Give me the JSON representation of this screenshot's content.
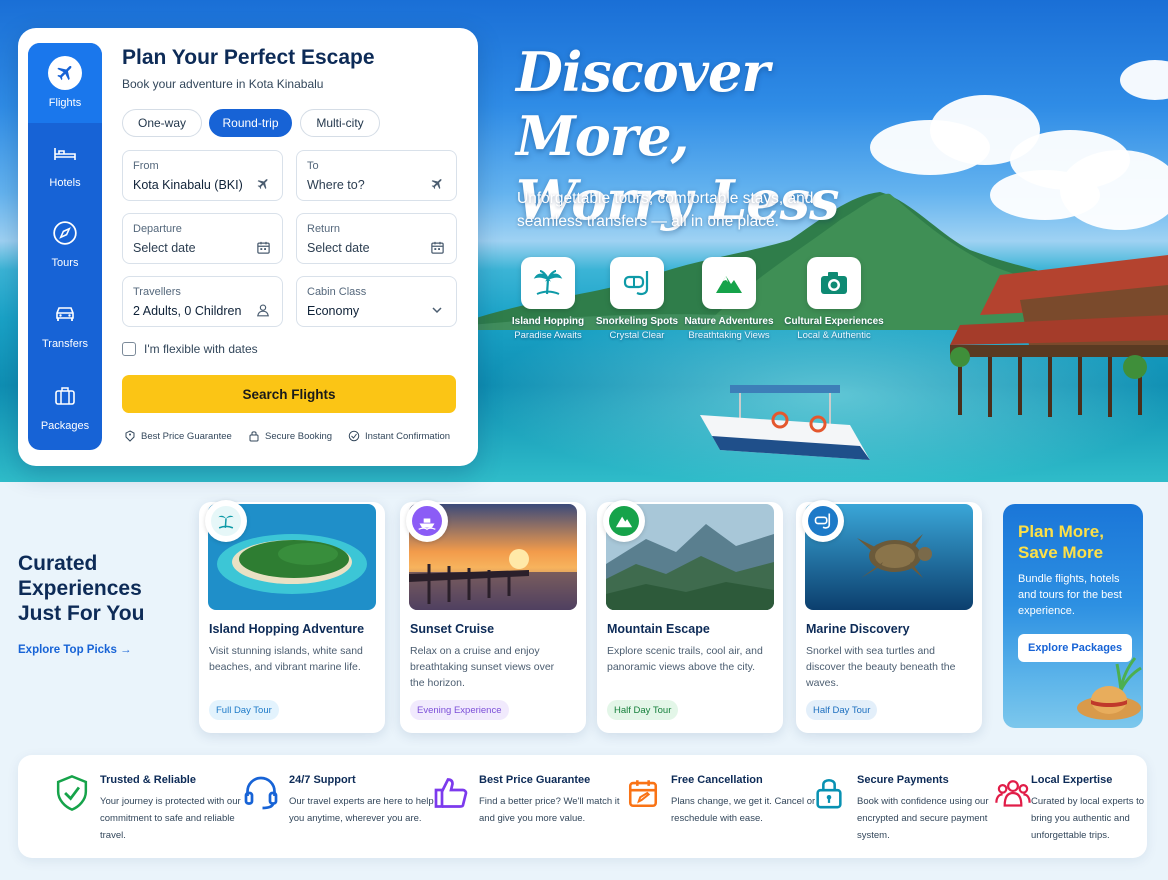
{
  "booking": {
    "tabs": [
      {
        "label": "Flights",
        "icon": "plane-icon"
      },
      {
        "label": "Hotels",
        "icon": "bed-icon"
      },
      {
        "label": "Tours",
        "icon": "compass-icon"
      },
      {
        "label": "Transfers",
        "icon": "car-icon"
      },
      {
        "label": "Packages",
        "icon": "suitcase-icon"
      }
    ],
    "title": "Plan Your Perfect Escape",
    "subtitle": "Book your adventure in Kota Kinabalu",
    "trip_types": [
      "One-way",
      "Round-trip",
      "Multi-city"
    ],
    "active_trip_type": "Round-trip",
    "fields": {
      "from": {
        "label": "From",
        "value": "Kota Kinabalu (BKI)"
      },
      "to": {
        "label": "To",
        "placeholder": "Where to?"
      },
      "departure": {
        "label": "Departure",
        "placeholder": "Select date"
      },
      "return": {
        "label": "Return",
        "placeholder": "Select date"
      },
      "travellers": {
        "label": "Travellers",
        "value": "2 Adults, 0 Children"
      },
      "cabin": {
        "label": "Cabin Class",
        "value": "Economy"
      }
    },
    "flexible_label": "I'm flexible with dates",
    "search_label": "Search Flights",
    "assurances": [
      "Best Price Guarantee",
      "Secure Booking",
      "Instant Confirmation"
    ]
  },
  "hero": {
    "title_line1": "Discover More,",
    "title_line2": "Worry Less",
    "subtitle": "Unforgettable tours, comfortable stays, and seamless transfers — all in one place.",
    "features": [
      {
        "title": "Island Hopping",
        "sub": "Paradise Awaits",
        "icon": "palm-tree-icon"
      },
      {
        "title": "Snorkeling Spots",
        "sub": "Crystal Clear",
        "icon": "snorkel-mask-icon"
      },
      {
        "title": "Nature Adventures",
        "sub": "Breathtaking Views",
        "icon": "mountain-icon"
      },
      {
        "title": "Cultural Experiences",
        "sub": "Local & Authentic",
        "icon": "camera-icon"
      }
    ]
  },
  "curated": {
    "title": "Curated Experiences Just For You",
    "link": "Explore Top Picks →",
    "tours": [
      {
        "title": "Island Hopping Adventure",
        "desc": "Visit stunning islands, white sand beaches, and vibrant marine life.",
        "tag": "Full Day Tour"
      },
      {
        "title": "Sunset Cruise",
        "desc": "Relax on a cruise and enjoy breathtaking sunset views over the horizon.",
        "tag": "Evening Experience"
      },
      {
        "title": "Mountain Escape",
        "desc": "Explore scenic trails, cool air, and panoramic views above the city.",
        "tag": "Half Day Tour"
      },
      {
        "title": "Marine Discovery",
        "desc": "Snorkel with sea turtles and discover the beauty beneath the waves.",
        "tag": "Half Day Tour"
      }
    ],
    "promo": {
      "title": "Plan More, Save More",
      "desc": "Bundle flights, hotels and tours for the best experience.",
      "button": "Explore Packages"
    }
  },
  "trust": [
    {
      "title": "Trusted & Reliable",
      "desc": "Your journey is protected with our commitment to safe and reliable travel.",
      "icon": "shield-check-icon",
      "color": "#16a34a"
    },
    {
      "title": "24/7 Support",
      "desc": "Our travel experts are here to help you anytime, wherever you are.",
      "icon": "headset-icon",
      "color": "#1763d6"
    },
    {
      "title": "Best Price Guarantee",
      "desc": "Find a better price? We'll match it and give you more value.",
      "icon": "thumbs-up-icon",
      "color": "#7c3aed"
    },
    {
      "title": "Free Cancellation",
      "desc": "Plans change, we get it. Cancel or reschedule with ease.",
      "icon": "calendar-edit-icon",
      "color": "#f97316"
    },
    {
      "title": "Secure Payments",
      "desc": "Book with confidence using our encrypted and secure payment system.",
      "icon": "lock-icon",
      "color": "#0891b2"
    },
    {
      "title": "Local Expertise",
      "desc": "Curated by local experts to bring you authentic and unforgettable trips.",
      "icon": "people-icon",
      "color": "#e11d48"
    }
  ],
  "colors": {
    "primary": "#1763d6",
    "accent": "#fbc515",
    "promo_title": "#fde047"
  }
}
